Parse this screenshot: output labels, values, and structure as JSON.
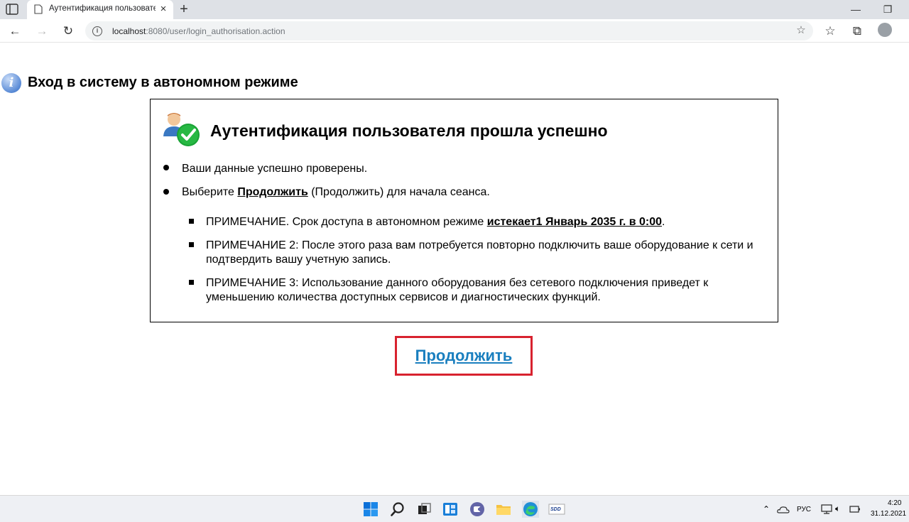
{
  "browser": {
    "tab_title": "Аутентификация пользователя",
    "address": {
      "host": "localhost",
      "path": ":8080/user/login_authorisation.action"
    }
  },
  "page": {
    "title": "Вход в систему в автономном режиме",
    "box": {
      "heading": "Аутентификация пользователя прошла успешно",
      "item1": "Ваши данные успешно проверены.",
      "item2_prefix": "Выберите ",
      "item2_link": "Продолжить",
      "item2_suffix": " (Продолжить) для начала сеанса.",
      "note1_prefix": "ПРИМЕЧАНИЕ. Срок доступа в автономном режиме ",
      "note1_link": "истекает1 Январь 2035 г. в 0:00",
      "note1_suffix": ".",
      "note2": "ПРИМЕЧАНИЕ 2: После этого раза вам потребуется повторно подключить ваше оборудование к сети и подтвердить вашу учетную запись.",
      "note3": "ПРИМЕЧАНИЕ 3: Использование данного оборудования без сетевого подключения приведет к уменьшению количества доступных сервисов и диагностических функций."
    },
    "continue_label": "Продолжить"
  },
  "taskbar": {
    "app_sdd": "SDD",
    "lang": "РУС",
    "time": "4:20",
    "date": "31.12.2021"
  }
}
